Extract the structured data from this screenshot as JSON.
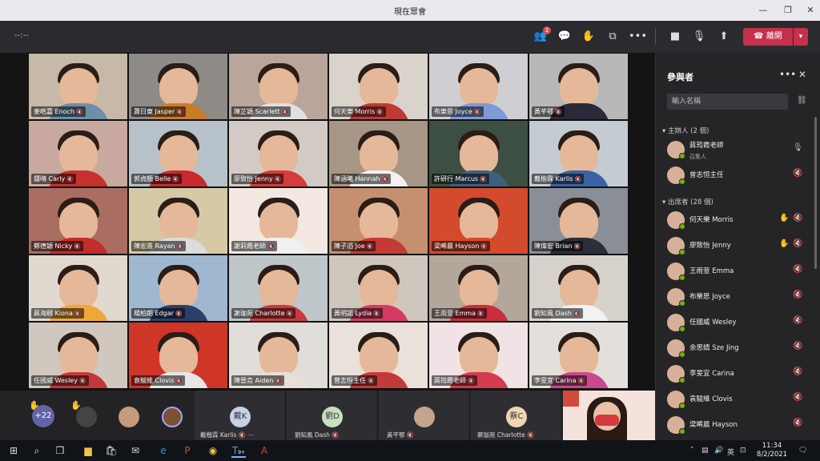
{
  "window": {
    "title": "現在眾會",
    "min": "—",
    "restore": "❐",
    "close": "✕"
  },
  "toolbar": {
    "timer": "--:--",
    "participants_badge": "2",
    "leave_label": "離開",
    "leave_color": "#c4314b"
  },
  "grid": [
    {
      "label": "麥晧嘉 Enoch",
      "bg": "#c7b9a7",
      "shirt": "#6f8ea8"
    },
    {
      "label": "蕭日東 Jasper",
      "bg": "#8e8a86",
      "shirt": "#c97b2a"
    },
    {
      "label": "陳芷穎 Scarlett",
      "bg": "#b9a59a",
      "shirt": "#e0e0e0"
    },
    {
      "label": "何天樂 Morris",
      "bg": "#dad3cc",
      "shirt": "#c03a33"
    },
    {
      "label": "布樂思 Joyce",
      "bg": "#cfcfd3",
      "shirt": "#7e9bd8"
    },
    {
      "label": "黃芊鄂",
      "bg": "#b8b8b8",
      "shirt": "#2a2a38"
    },
    {
      "label": "鍾晴 Carly",
      "bg": "#c9a99f",
      "shirt": "#c8312b"
    },
    {
      "label": "郭貞顏 Belle",
      "bg": "#b7c1c9",
      "shirt": "#c72b2f"
    },
    {
      "label": "廖致怡 Jenny",
      "bg": "#d2cbc5",
      "shirt": "#d53c3a"
    },
    {
      "label": "陳涵曦 Hannah",
      "bg": "#a79585",
      "shirt": "#f2f2f2"
    },
    {
      "label": "許研行 Marcus",
      "bg": "#3d4f42",
      "shirt": "#3f5f7f"
    },
    {
      "label": "戴楷霖 Karlis",
      "bg": "#c4cbd3",
      "shirt": "#3b63a3"
    },
    {
      "label": "鄭德穎 Nicky",
      "bg": "#a96d62",
      "shirt": "#c32d2a"
    },
    {
      "label": "陳宏熹 Rayan",
      "bg": "#d6c9a6",
      "shirt": "#dcdcdc"
    },
    {
      "label": "謝莉霞老師",
      "bg": "#f4e8e2",
      "shirt": "#f0f0f0"
    },
    {
      "label": "陳子滔 Joe",
      "bg": "#c68f70",
      "shirt": "#c43a34"
    },
    {
      "label": "梁晞晨 Hayson",
      "bg": "#d44a2c",
      "shirt": "#d44a2c"
    },
    {
      "label": "陳偉宏 Brian",
      "bg": "#8a8e96",
      "shirt": "#2a2f3a"
    },
    {
      "label": "蔣海翹 Kiona",
      "bg": "#e1d9cf",
      "shirt": "#f0a73a"
    },
    {
      "label": "楊柏朗 Edgar",
      "bg": "#9fb7cf",
      "shirt": "#2c3e6a"
    },
    {
      "label": "謝珈苑 Charlotte",
      "bg": "#bfc6c9",
      "shirt": "#c73a3f"
    },
    {
      "label": "黃明諾 Lydia",
      "bg": "#cfc6bd",
      "shirt": "#d53a60"
    },
    {
      "label": "王雨萱 Emma",
      "bg": "#b2a79a",
      "shirt": "#c92f3a"
    },
    {
      "label": "劉知風 Dash",
      "bg": "#d7d1cb",
      "shirt": "#f2f2f2"
    },
    {
      "label": "任國威 Wesley",
      "bg": "#d0c8be",
      "shirt": "#c5383a"
    },
    {
      "label": "袁駿維 Clovis",
      "bg": "#cf3627",
      "shirt": "#e6e6e6"
    },
    {
      "label": "陳晉垚 Aiden",
      "bg": "#e1ddd8",
      "shirt": "#e6e0d8"
    },
    {
      "label": "曾志恒主任",
      "bg": "#e9e1da",
      "shirt": "#c23a3a"
    },
    {
      "label": "蔣筠霞老師",
      "bg": "#f1e2e5",
      "shirt": "#d43b4f"
    },
    {
      "label": "李旻宜 Carina",
      "bg": "#e3dfdb",
      "shirt": "#c84a8c"
    },
    {
      "label": "余思婧 Sze Jing",
      "bg": "#c8b7ae",
      "shirt": "#c0303a"
    }
  ],
  "strip": {
    "more_count": "+22",
    "tiles": [
      {
        "initials": "戴K",
        "label": "戴楷霖 Karlis",
        "avatar_color": "#c8d0e8"
      },
      {
        "initials": "劉D",
        "label": "劉知風 Dash",
        "avatar_color": "#c9e0c0"
      },
      {
        "initials": "",
        "label": "黃芊鄂",
        "avatar_color": "#c5a48d"
      },
      {
        "initials": "蔡C",
        "label": "蔡珈苑 Charlotte",
        "avatar_color": "#f0d6b0"
      }
    ],
    "more_icon": "⋯"
  },
  "panel": {
    "title": "參與者",
    "search_placeholder": "輸入名稱",
    "organizers_head": "主辦人 (2 個)",
    "attendees_head": "出席者 (28 個)",
    "organizers": [
      {
        "name": "蔣筠霞老師",
        "sub": "召集人",
        "mic": "🎙"
      },
      {
        "name": "曾志恒主任",
        "sub": "",
        "mic": "🔇"
      }
    ],
    "attendees": [
      {
        "name": "何天樂 Morris",
        "hand": true
      },
      {
        "name": "廖致怡 Jenny",
        "hand": true
      },
      {
        "name": "王雨萱 Emma",
        "hand": false
      },
      {
        "name": "布樂思 Joyce",
        "hand": false
      },
      {
        "name": "任國威 Wesley",
        "hand": false
      },
      {
        "name": "余思婧 Sze Jing",
        "hand": false
      },
      {
        "name": "李旻宜 Carina",
        "hand": false
      },
      {
        "name": "袁駿維 Clovis",
        "hand": false
      },
      {
        "name": "梁晞晨 Hayson",
        "hand": false
      }
    ]
  },
  "taskbar": {
    "time": "11:34",
    "date": "8/2/2021",
    "lang": "英",
    "teams_badge": "9+"
  }
}
